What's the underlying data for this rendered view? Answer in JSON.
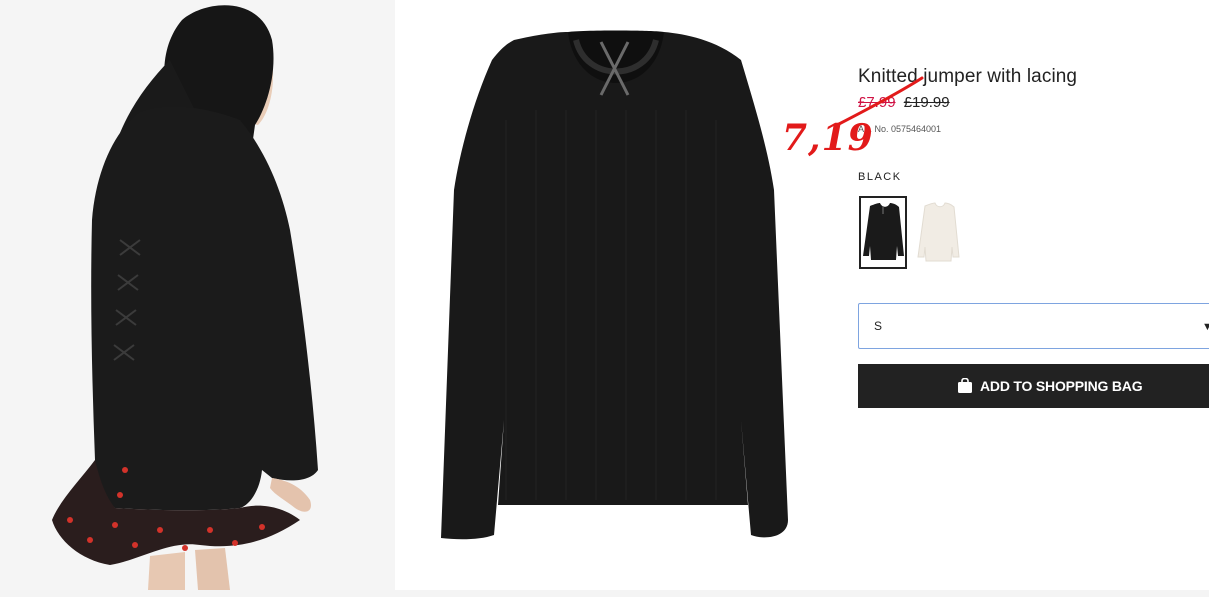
{
  "product": {
    "title": "Knitted jumper with lacing",
    "sale_price": "£7.99",
    "original_price": "£19.99",
    "article_number": "Art. No. 0575464001",
    "selected_color": "BLACK",
    "color_options": [
      "black",
      "white"
    ]
  },
  "annotation": {
    "handwritten_price": "7,19",
    "color": "#e21a1a"
  },
  "size_select": {
    "value": "S"
  },
  "actions": {
    "add_to_bag_label": "ADD TO SHOPPING BAG"
  },
  "colors": {
    "sale_red": "#d01345",
    "button_bg": "#222222",
    "select_border": "#7ea4e0"
  },
  "icons": {
    "chevron": "chevron-down-icon",
    "bag": "shopping-bag-icon"
  }
}
